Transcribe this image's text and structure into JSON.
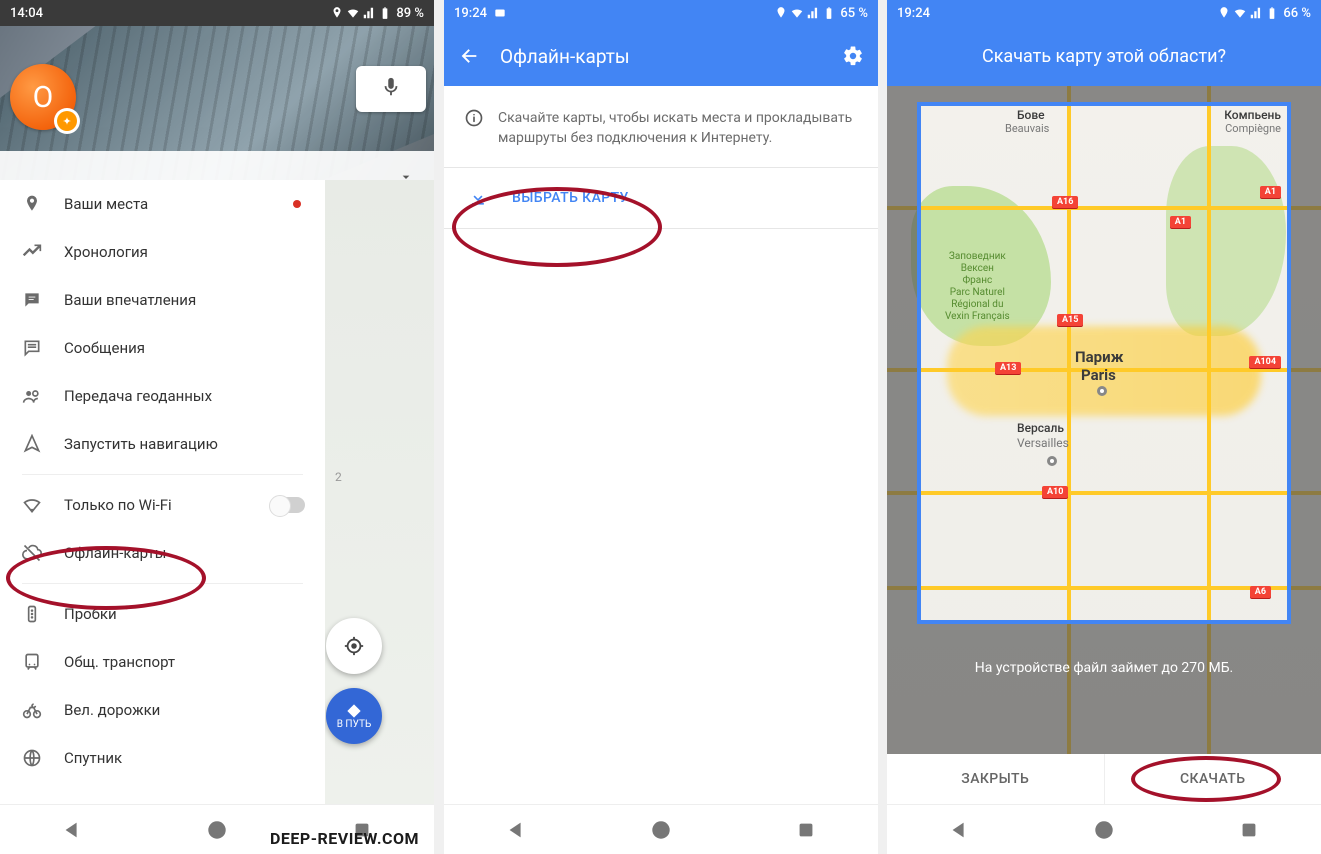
{
  "watermark": "deep-review.com",
  "phone1": {
    "time": "14:04",
    "battery": "89 %",
    "avatar_letter": "О",
    "menu": {
      "places": "Ваши места",
      "timeline": "Хронология",
      "impressions": "Ваши впечатления",
      "messages": "Сообщения",
      "geo_share": "Передача геоданных",
      "start_nav": "Запустить навигацию",
      "wifi_only": "Только по Wi-Fi",
      "offline_maps": "Офлайн-карты",
      "traffic": "Пробки",
      "transit": "Общ. транспорт",
      "cycling": "Вел. дорожки",
      "satellite": "Спутник"
    },
    "fab_go": "В ПУТЬ",
    "map_badge": "2"
  },
  "phone2": {
    "time": "19:24",
    "battery": "65 %",
    "title": "Офлайн-карты",
    "info": "Скачайте карты, чтобы искать места и прокладывать маршруты без подключения к Интернету.",
    "select_btn": "ВЫБРАТЬ КАРТУ"
  },
  "phone3": {
    "time": "19:24",
    "battery": "66 %",
    "title": "Скачать карту этой области?",
    "storage": "На устройстве файл займет до 270 МБ.",
    "close": "ЗАКРЫТЬ",
    "download": "СКАЧАТЬ",
    "labels": {
      "bove": "Бове",
      "beauvais": "Beauvais",
      "compiegne": "Компьень",
      "compiegne_en": "Compiègne",
      "paris_ru": "Париж",
      "paris_en": "Paris",
      "versailles_ru": "Версаль",
      "versailles_en": "Versailles",
      "vexin": "Заповедник\nВексен\nФранс\nParc Naturel\nRégional du\nVexin Français"
    },
    "road_markers": [
      "A16",
      "A1",
      "A15",
      "A104",
      "A13",
      "A10",
      "A6",
      "A16"
    ]
  }
}
